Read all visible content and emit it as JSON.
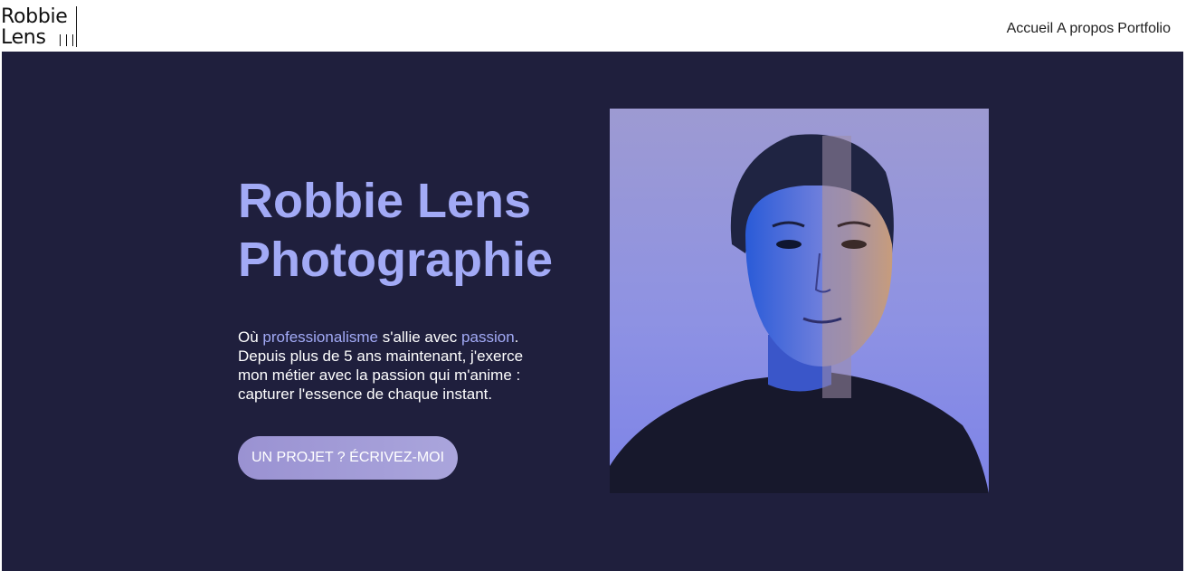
{
  "header": {
    "logo": {
      "line1": "Robbie",
      "line2": "Lens"
    },
    "nav": [
      {
        "label": "Accueil"
      },
      {
        "label": "A propos"
      },
      {
        "label": "Portfolio"
      }
    ]
  },
  "hero": {
    "title_line1": "Robbie Lens",
    "title_line2": "Photographie",
    "description": {
      "prefix": "Où ",
      "highlight1": "professionalisme",
      "middle": " s'allie avec ",
      "highlight2": "passion",
      "suffix": ". Depuis plus de 5 ans maintenant, j'exerce mon métier avec la passion qui m'anime : capturer l'essence de chaque instant."
    },
    "cta_label": "UN PROJET ? ÉCRIVEZ-MOI"
  },
  "colors": {
    "hero_background": "#1f1f3d",
    "accent": "#a2aaf6",
    "button": "#a39dd8"
  }
}
